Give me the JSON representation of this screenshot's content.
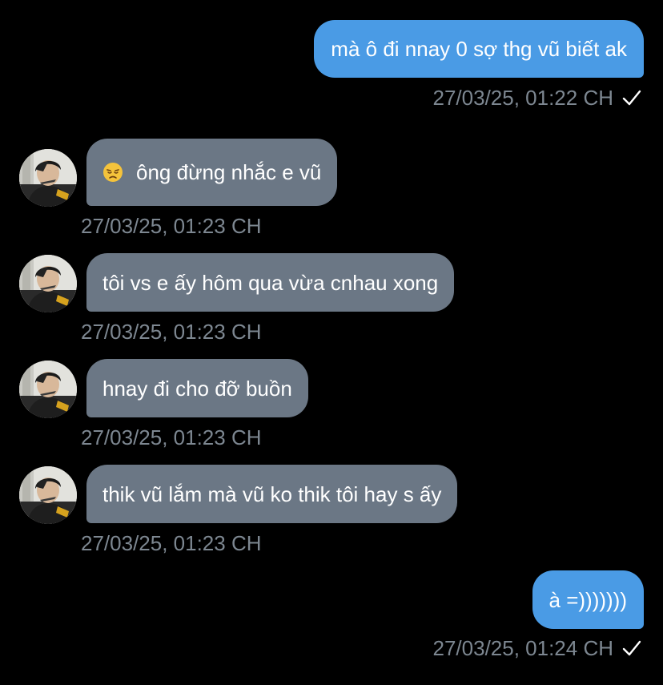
{
  "messages": [
    {
      "direction": "outgoing",
      "text": "mà ô đi nnay 0 sợ thg vũ biết ak",
      "timestamp": "27/03/25, 01:22 CH",
      "read_status": "sent-check-icon"
    },
    {
      "direction": "incoming",
      "emoji": "disappointed-face-icon",
      "text": "ông đừng nhắc e vũ",
      "timestamp": "27/03/25, 01:23 CH"
    },
    {
      "direction": "incoming",
      "text": "tôi vs e ấy hôm qua vừa cnhau xong",
      "timestamp": "27/03/25, 01:23 CH"
    },
    {
      "direction": "incoming",
      "text": "hnay đi cho đỡ buồn",
      "timestamp": "27/03/25, 01:23 CH"
    },
    {
      "direction": "incoming",
      "text": "thik vũ lắm mà vũ ko thik tôi hay s ấy",
      "timestamp": "27/03/25, 01:23 CH"
    },
    {
      "direction": "outgoing",
      "text": "à =)))))))",
      "timestamp": "27/03/25, 01:24 CH",
      "read_status": "sent-check-icon"
    }
  ],
  "colors": {
    "background": "#000000",
    "outgoing_bubble": "#4a9be5",
    "incoming_bubble": "#6b7785",
    "timestamp": "#7d8791",
    "text": "#ffffff"
  }
}
